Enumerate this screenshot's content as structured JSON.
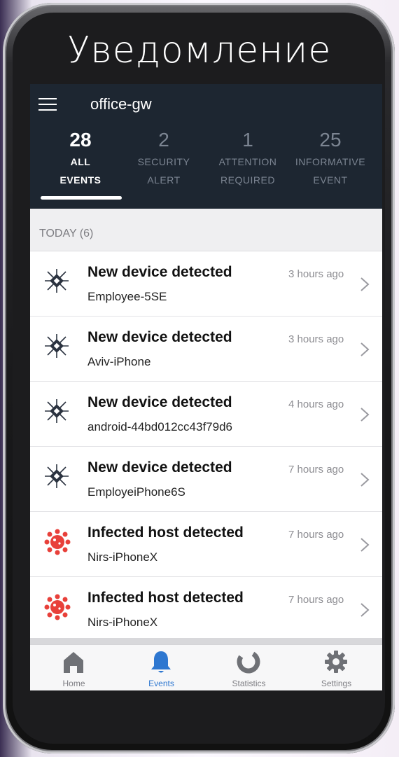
{
  "banner": {
    "title": "Уведомление"
  },
  "header": {
    "gateway_name": "office-gw"
  },
  "tabs": [
    {
      "count": "28",
      "label": "ALL\nEVENTS",
      "active": true
    },
    {
      "count": "2",
      "label": "SECURITY\nALERT",
      "active": false
    },
    {
      "count": "1",
      "label": "ATTENTION\nREQUIRED",
      "active": false
    },
    {
      "count": "25",
      "label": "INFORMATIVE\nEVENT",
      "active": false
    }
  ],
  "section": {
    "label": "TODAY (6)"
  },
  "events": [
    {
      "type": "device",
      "icon": "new-device-icon",
      "title": "New device detected",
      "subtitle": "Employee-5SE",
      "time": "3 hours ago"
    },
    {
      "type": "device",
      "icon": "new-device-icon",
      "title": "New device detected",
      "subtitle": "Aviv-iPhone",
      "time": "3 hours ago"
    },
    {
      "type": "device",
      "icon": "new-device-icon",
      "title": "New device detected",
      "subtitle": "android-44bd012cc43f79d6",
      "time": "4 hours ago"
    },
    {
      "type": "device",
      "icon": "new-device-icon",
      "title": "New device detected",
      "subtitle": "EmployeiPhone6S",
      "time": "7 hours ago"
    },
    {
      "type": "infected",
      "icon": "virus-icon",
      "title": "Infected host detected",
      "subtitle": "Nirs-iPhoneX",
      "time": "7 hours ago"
    },
    {
      "type": "infected",
      "icon": "virus-icon",
      "title": "Infected host detected",
      "subtitle": "Nirs-iPhoneX",
      "time": "7 hours ago"
    }
  ],
  "tabbar": {
    "items": [
      {
        "label": "Home",
        "icon": "home-icon",
        "active": false
      },
      {
        "label": "Events",
        "icon": "bell-icon",
        "active": true
      },
      {
        "label": "Statistics",
        "icon": "statistics-icon",
        "active": false
      },
      {
        "label": "Settings",
        "icon": "gear-icon",
        "active": false
      }
    ]
  },
  "colors": {
    "topbar": "#1d2631",
    "accent": "#2e77d0",
    "alert": "#e8403a",
    "device_icon": "#2b3340"
  }
}
